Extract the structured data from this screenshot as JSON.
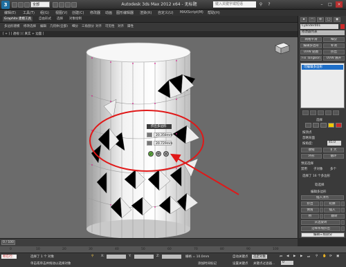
{
  "titlebar": {
    "app_title": "Autodesk 3ds Max 2012 x64",
    "file_name": "无标题",
    "workspace_combo": "全部",
    "search_placeholder": "键入关键字或短语",
    "logo": "3"
  },
  "menubar": {
    "items": [
      "编辑(E)",
      "工具(T)",
      "组(G)",
      "视图(V)",
      "创建(C)",
      "修改器",
      "动画",
      "图形编辑器",
      "渲染(R)",
      "自定义(U)",
      "MAXScript(M)",
      "帮助(H)"
    ]
  },
  "ribbon": {
    "tabs": [
      "Graphite 建模工具",
      "自由形式",
      "选择",
      "对象绘制"
    ],
    "active_tab": 0,
    "sub_items": [
      "多边形建模",
      "修改选择",
      "编辑",
      "几何体(全部)",
      "细分",
      "三角剖分",
      "对齐",
      "可见性",
      "对齐",
      "属性"
    ]
  },
  "viewport": {
    "label": "[ + ] [ 透视 ] [ 真实 + 边面 ]",
    "caddy": {
      "title": "挤出多边形",
      "height": "20.358mm",
      "width": "20.729mm"
    }
  },
  "command_panel": {
    "object_name": "Cylinder001",
    "modifier_list": "修改器列表",
    "buttons": [
      "网格平滑",
      "细分",
      "编辑多边形",
      "补洞",
      "UVW 贴图",
      "挤出",
      "Fix TangBon",
      "UVW 展开"
    ],
    "stack_item": "可编辑多边形",
    "selection_title": "选择",
    "by_vertex": "按顶点",
    "ignore_back": "忽略背面",
    "by_angle": "按角度：",
    "angle_value": "45.0",
    "shrink": "收缩",
    "grow": "扩大",
    "ring": "环形",
    "loop": "循环",
    "preview_title": "预览选择",
    "off": "禁用",
    "subobj": "子对象",
    "multi": "多个",
    "selected_count": "选择了 16 个多边形",
    "soft_sel": "软选择",
    "edit_poly_title": "编辑多边形",
    "insert_vertex": "插入顶点",
    "extrude": "挤出",
    "outline": "轮廓",
    "bevel": "倒角",
    "inset": "插入",
    "bridge": "桥",
    "flip": "翻转",
    "hinge": "从边旋转",
    "extrude_spline": "沿样条线挤出",
    "edit_tri": "编辑三角剖分",
    "retri": "重复三角算法",
    "turn": "旋转"
  },
  "trackbar": {
    "frame_label": "0 / 100",
    "ticks": [
      "0",
      "10",
      "20",
      "30",
      "40",
      "50",
      "60",
      "70",
      "80",
      "90",
      "100"
    ]
  },
  "status": {
    "script_label": "所在行：",
    "selected_text": "选择了 1 个 对象",
    "prompt_text": "单击或单击并拖动以选择对象",
    "x_label": "X:",
    "y_label": "Y:",
    "z_label": "Z:",
    "grid": "栅格 = 10.0mm",
    "auto_key": "自动关键点",
    "set_key": "设置关键点",
    "selected_dropdown": "选定对象",
    "key_filter": "关键点过滤器...",
    "add_time_tag": "添加时间标记",
    "frame": "0"
  },
  "colors": {
    "accent": "#f0c800",
    "annotation": "#e01818",
    "selection": "#1e6fc8"
  }
}
